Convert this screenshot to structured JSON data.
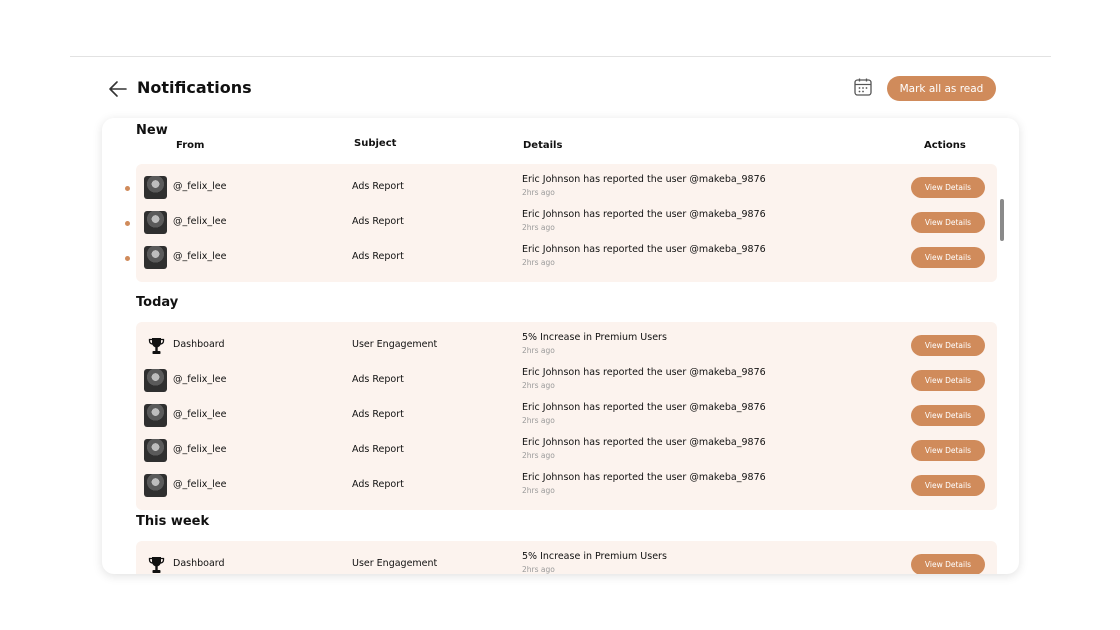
{
  "header": {
    "title": "Notifications",
    "mark_all_label": "Mark all as read"
  },
  "columns": {
    "from": "From",
    "subject": "Subject",
    "details": "Details",
    "actions": "Actions"
  },
  "icons": {
    "back": "arrow-left-icon",
    "calendar": "calendar-icon",
    "trophy": "trophy-icon",
    "avatar": "avatar"
  },
  "colors": {
    "accent": "#d08b5b",
    "row_bg": "#fcf3ee"
  },
  "sections": [
    {
      "title": "New",
      "rows": [
        {
          "unread": true,
          "type": "user",
          "from": "@_felix_lee",
          "subject": "Ads Report",
          "details": "Eric Johnson has reported the user @makeba_9876",
          "time": "2hrs ago",
          "action": "View Details"
        },
        {
          "unread": true,
          "type": "user",
          "from": "@_felix_lee",
          "subject": "Ads Report",
          "details": "Eric Johnson has reported the user @makeba_9876",
          "time": "2hrs ago",
          "action": "View Details"
        },
        {
          "unread": true,
          "type": "user",
          "from": "@_felix_lee",
          "subject": "Ads Report",
          "details": "Eric Johnson has reported the user @makeba_9876",
          "time": "2hrs ago",
          "action": "View Details"
        }
      ]
    },
    {
      "title": "Today",
      "rows": [
        {
          "unread": false,
          "type": "system",
          "from": "Dashboard",
          "subject": "User Engagement",
          "details": "5% Increase in Premium Users",
          "time": "2hrs ago",
          "action": "View Details"
        },
        {
          "unread": false,
          "type": "user",
          "from": "@_felix_lee",
          "subject": "Ads Report",
          "details": "Eric Johnson has reported the user @makeba_9876",
          "time": "2hrs ago",
          "action": "View Details"
        },
        {
          "unread": false,
          "type": "user",
          "from": "@_felix_lee",
          "subject": "Ads Report",
          "details": "Eric Johnson has reported the user @makeba_9876",
          "time": "2hrs ago",
          "action": "View Details"
        },
        {
          "unread": false,
          "type": "user",
          "from": "@_felix_lee",
          "subject": "Ads Report",
          "details": "Eric Johnson has reported the user @makeba_9876",
          "time": "2hrs ago",
          "action": "View Details"
        },
        {
          "unread": false,
          "type": "user",
          "from": "@_felix_lee",
          "subject": "Ads Report",
          "details": "Eric Johnson has reported the user @makeba_9876",
          "time": "2hrs ago",
          "action": "View Details"
        }
      ]
    },
    {
      "title": "This week",
      "rows": [
        {
          "unread": false,
          "type": "system",
          "from": "Dashboard",
          "subject": "User Engagement",
          "details": "5% Increase in Premium Users",
          "time": "2hrs ago",
          "action": "View Details"
        }
      ]
    }
  ]
}
